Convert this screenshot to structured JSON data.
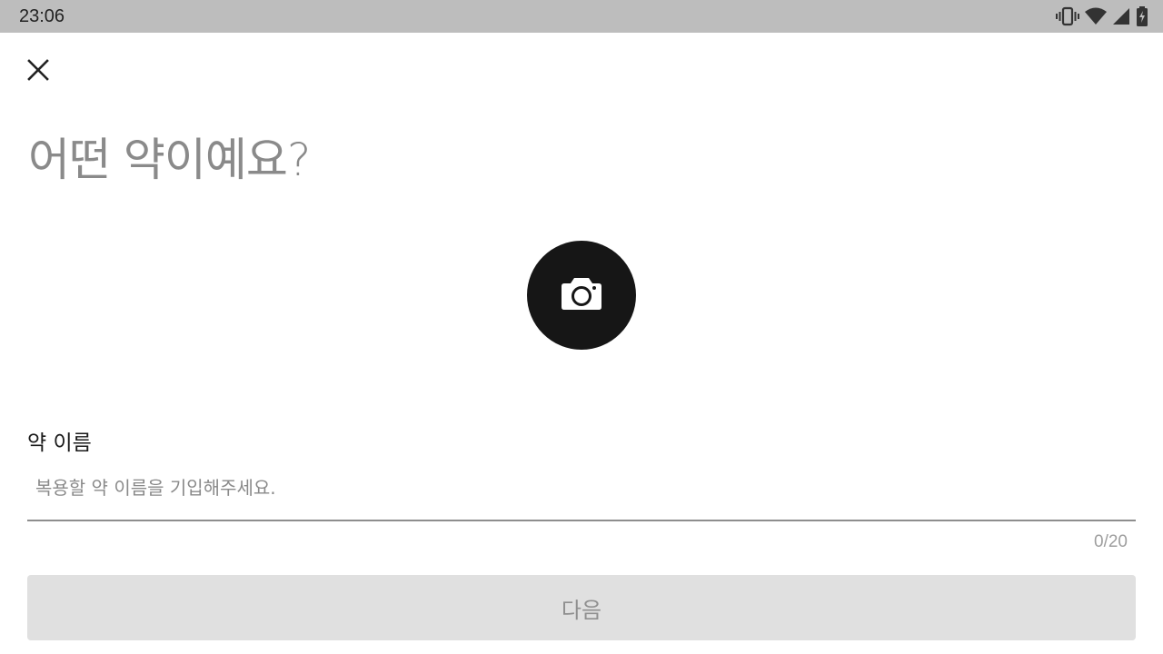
{
  "status_bar": {
    "time": "23:06",
    "icons": [
      "vibrate-icon",
      "wifi-icon",
      "cell-signal-icon",
      "battery-charging-icon"
    ]
  },
  "header": {
    "close_icon": "close-icon"
  },
  "title": "어떤 약이예요?",
  "camera": {
    "icon": "camera-icon"
  },
  "form": {
    "label": "약 이름",
    "value": "",
    "placeholder": "복용할 약 이름을 기입해주세요.",
    "counter": "0/20"
  },
  "next_button": {
    "label": "다음"
  },
  "colors": {
    "status_bar_bg": "#bdbdbd",
    "camera_bg": "#161616",
    "button_disabled_bg": "#e0e0e0",
    "button_disabled_text": "#8f8f8f"
  }
}
